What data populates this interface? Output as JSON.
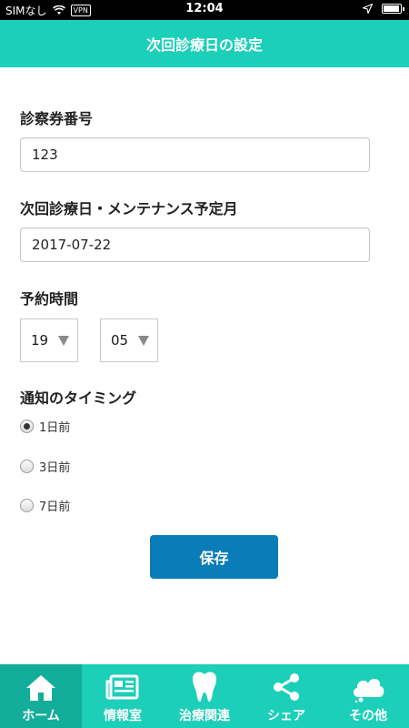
{
  "status_bar": {
    "carrier": "SIMなし",
    "vpn": "VPN",
    "time": "12:04"
  },
  "header": {
    "title": "次回診療日の設定"
  },
  "form": {
    "card_number": {
      "label": "診察券番号",
      "value": "123"
    },
    "next_visit": {
      "label": "次回診療日・メンテナンス予定月",
      "value": "2017-07-22"
    },
    "reservation_time": {
      "label": "予約時間",
      "hour": "19",
      "minute": "05"
    },
    "notification": {
      "label": "通知のタイミング",
      "options": [
        "1日前",
        "3日前",
        "7日前"
      ],
      "selected": "1日前"
    },
    "save_label": "保存"
  },
  "tabbar": {
    "items": [
      {
        "label": "ホーム",
        "icon": "home-icon",
        "active": true
      },
      {
        "label": "情報室",
        "icon": "newspaper-icon",
        "active": false
      },
      {
        "label": "治療関連",
        "icon": "tooth-icon",
        "active": false
      },
      {
        "label": "シェア",
        "icon": "share-icon",
        "active": false
      },
      {
        "label": "その他",
        "icon": "cloud-icon",
        "active": false
      }
    ]
  },
  "colors": {
    "accent": "#1ccfb8",
    "accent_active": "#12ae9a",
    "button": "#0a7db9"
  }
}
